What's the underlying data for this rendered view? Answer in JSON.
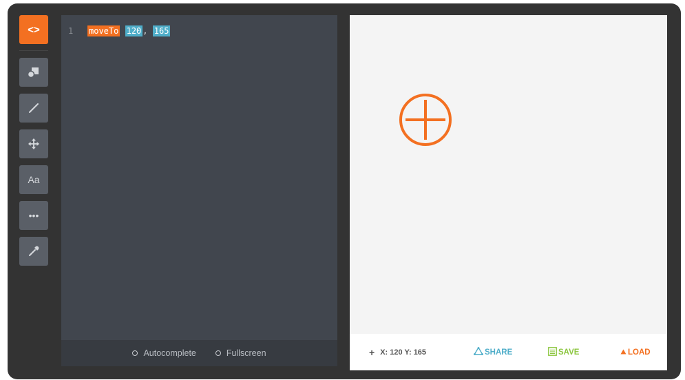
{
  "toolbar": {
    "code_label": "<>",
    "tools": [
      {
        "name": "shapes",
        "icon": "shapes-icon"
      },
      {
        "name": "line",
        "icon": "line-icon"
      },
      {
        "name": "move",
        "icon": "move-icon"
      },
      {
        "name": "text",
        "icon": "text-icon",
        "label": "Aa"
      },
      {
        "name": "more",
        "icon": "more-icon",
        "label": "•••"
      },
      {
        "name": "eyedropper",
        "icon": "eyedropper-icon"
      }
    ]
  },
  "editor": {
    "line_number": "1",
    "command": "moveTo",
    "arg1": "120",
    "separator": ",",
    "arg2": "165"
  },
  "editor_footer": {
    "autocomplete_label": "Autocomplete",
    "fullscreen_label": "Fullscreen"
  },
  "status": {
    "coords": "X: 120 Y: 165",
    "share_label": "SHARE",
    "save_label": "SAVE",
    "load_label": "LOAD"
  },
  "colors": {
    "accent": "#f37021",
    "share": "#4faec9",
    "save": "#8cc63f",
    "panel_bg": "#333333",
    "editor_bg": "#41464e"
  }
}
